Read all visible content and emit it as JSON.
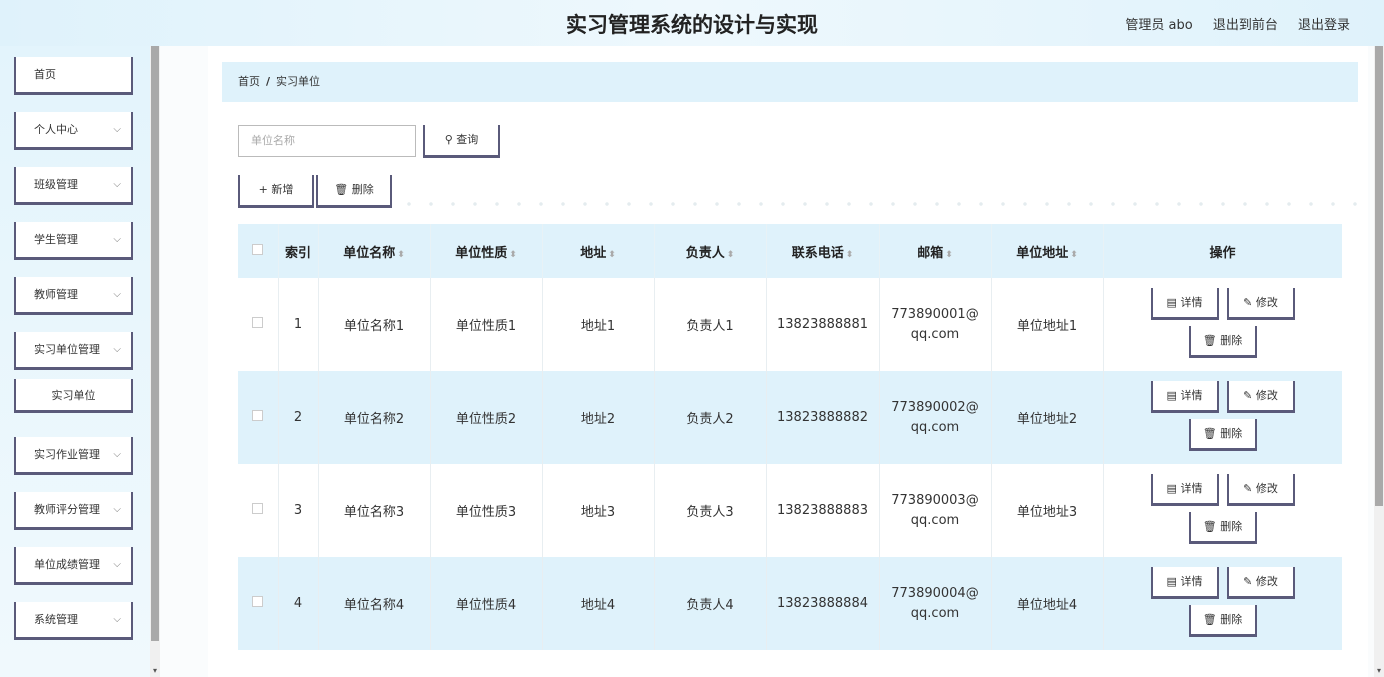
{
  "header": {
    "title": "实习管理系统的设计与实现",
    "user": "管理员 abo",
    "back_front": "退出到前台",
    "logout": "退出登录"
  },
  "sidebar": {
    "items": [
      {
        "label": "首页",
        "chevron": ""
      },
      {
        "label": "个人中心",
        "chevron": "⌵"
      },
      {
        "label": "班级管理",
        "chevron": "⌵"
      },
      {
        "label": "学生管理",
        "chevron": "⌵"
      },
      {
        "label": "教师管理",
        "chevron": "⌵"
      },
      {
        "label": "实习单位管理",
        "chevron": "⌵"
      },
      {
        "label": "实习作业管理",
        "chevron": "⌵"
      },
      {
        "label": "教师评分管理",
        "chevron": "⌵"
      },
      {
        "label": "单位成绩管理",
        "chevron": "⌵"
      },
      {
        "label": "系统管理",
        "chevron": "⌵"
      }
    ],
    "sub_item": "实习单位"
  },
  "breadcrumb": {
    "home": "首页",
    "sep": "/",
    "current": "实习单位"
  },
  "search": {
    "placeholder": "单位名称",
    "button": "查询",
    "icon": "search-icon"
  },
  "toolbar": {
    "add": "新增",
    "delete": "删除"
  },
  "table": {
    "headers": [
      "索引",
      "单位名称",
      "单位性质",
      "地址",
      "负责人",
      "联系电话",
      "邮箱",
      "单位地址",
      "操作"
    ],
    "rows": [
      {
        "index": "1",
        "name": "单位名称1",
        "nature": "单位性质1",
        "addr": "地址1",
        "owner": "负责人1",
        "phone": "13823888881",
        "email": "773890001@qq.com",
        "unit_addr": "单位地址1"
      },
      {
        "index": "2",
        "name": "单位名称2",
        "nature": "单位性质2",
        "addr": "地址2",
        "owner": "负责人2",
        "phone": "13823888882",
        "email": "773890002@qq.com",
        "unit_addr": "单位地址2"
      },
      {
        "index": "3",
        "name": "单位名称3",
        "nature": "单位性质3",
        "addr": "地址3",
        "owner": "负责人3",
        "phone": "13823888883",
        "email": "773890003@qq.com",
        "unit_addr": "单位地址3"
      },
      {
        "index": "4",
        "name": "单位名称4",
        "nature": "单位性质4",
        "addr": "地址4",
        "owner": "负责人4",
        "phone": "13823888884",
        "email": "773890004@qq.com",
        "unit_addr": "单位地址4"
      }
    ],
    "op_labels": {
      "detail": "详情",
      "edit": "修改",
      "delete": "删除"
    }
  }
}
